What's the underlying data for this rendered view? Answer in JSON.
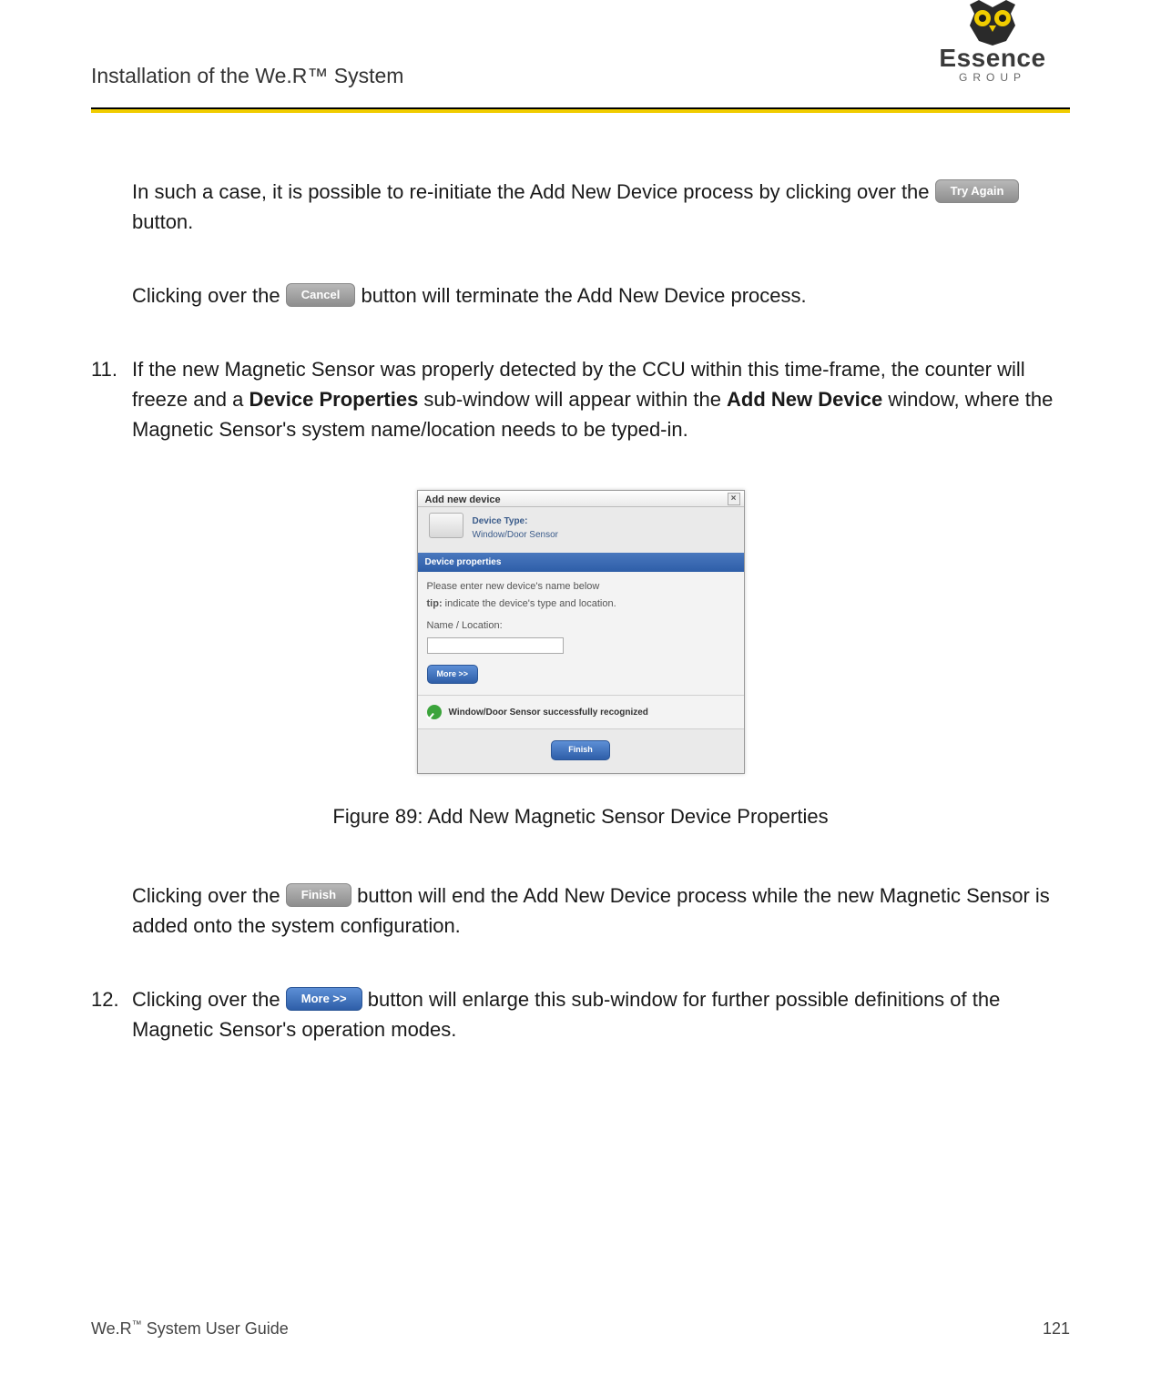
{
  "header": {
    "title": "Installation of the We.R™ System",
    "logo_text": "Essence",
    "logo_sub": "GROUP"
  },
  "buttons": {
    "try_again": "Try Again",
    "cancel": "Cancel",
    "finish": "Finish",
    "more": "More >>"
  },
  "paragraphs": {
    "p1_a": "In such a case, it is possible to re-initiate the Add New Device process by clicking over the ",
    "p1_b": " button.",
    "p2_a": "Clicking over the ",
    "p2_b": " button will terminate the Add New Device process.",
    "item11_num": "11.",
    "item11_a": "If the new Magnetic Sensor was properly detected by the CCU within this time-frame, the counter will freeze and a ",
    "item11_b": "Device Properties",
    "item11_c": " sub-window will appear within the ",
    "item11_d": "Add New Device",
    "item11_e": " window, where the Magnetic Sensor's system name/location needs to be typed-in.",
    "caption": "Figure 89: Add New Magnetic Sensor Device Properties",
    "p3_a": "Clicking over the ",
    "p3_b": " button will end the Add New Device process while the new Magnetic Sensor is added onto the system configuration.",
    "item12_num": "12.",
    "item12_a": "Clicking over the ",
    "item12_b": " button will enlarge this sub-window for further possible definitions of the Magnetic Sensor's operation modes."
  },
  "dialog": {
    "title": "Add new device",
    "type_label": "Device Type:",
    "type_value": "Window/Door Sensor",
    "bar": "Device properties",
    "prompt": "Please enter new device's name below",
    "tip_label": "tip:",
    "tip_text": " indicate the device's type and location.",
    "name_label": "Name / Location:",
    "more": "More >>",
    "success": "Window/Door Sensor successfully recognized",
    "finish": "Finish"
  },
  "footer": {
    "left_a": "We.R",
    "left_tm": "™",
    "left_b": " System User Guide",
    "page": "121"
  }
}
